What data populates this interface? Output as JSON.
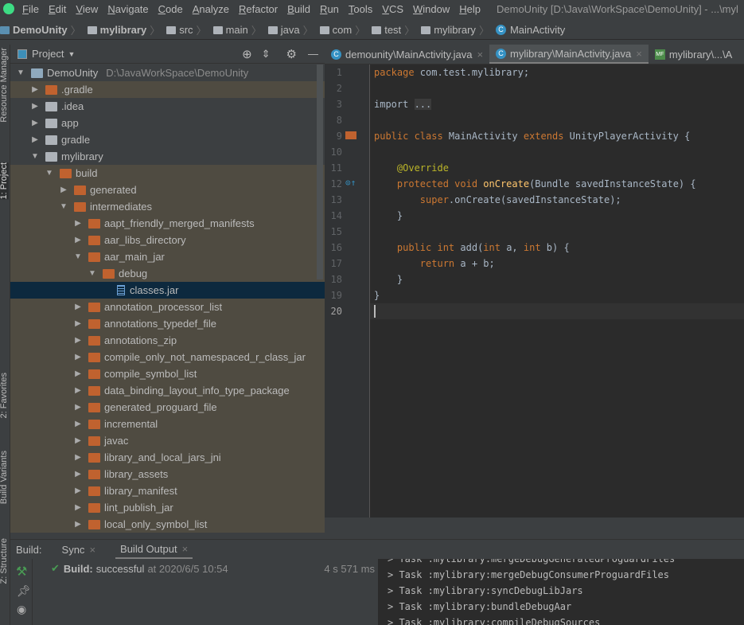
{
  "menu": [
    "File",
    "Edit",
    "View",
    "Navigate",
    "Code",
    "Analyze",
    "Refactor",
    "Build",
    "Run",
    "Tools",
    "VCS",
    "Window",
    "Help"
  ],
  "window_title": "DemoUnity [D:\\Java\\WorkSpace\\DemoUnity] - ...\\myl",
  "breadcrumb": [
    "DemoUnity",
    "mylibrary",
    "src",
    "main",
    "java",
    "com",
    "test",
    "mylibrary",
    "MainActivity"
  ],
  "left_strip": {
    "resource_manager": "Resource Manager",
    "project": "1: Project",
    "favorites": "2: Favorites",
    "build_variants": "Build Variants",
    "structure": "Z: Structure"
  },
  "project_panel": {
    "title": "Project",
    "root_path": "D:\\JavaWorkSpace\\DemoUnity"
  },
  "tree": [
    {
      "label": "DemoUnity",
      "depth": 0,
      "open": true,
      "icon": "module-folder",
      "excluded": false
    },
    {
      "label": ".gradle",
      "depth": 1,
      "open": false,
      "icon": "folder-excluded",
      "excluded": true
    },
    {
      "label": ".idea",
      "depth": 1,
      "open": false,
      "icon": "folder",
      "excluded": false
    },
    {
      "label": "app",
      "depth": 1,
      "open": false,
      "icon": "app-module",
      "excluded": false
    },
    {
      "label": "gradle",
      "depth": 1,
      "open": false,
      "icon": "folder",
      "excluded": false
    },
    {
      "label": "mylibrary",
      "depth": 1,
      "open": true,
      "icon": "library-module",
      "excluded": false
    },
    {
      "label": "build",
      "depth": 2,
      "open": true,
      "icon": "folder-excluded",
      "excluded": true
    },
    {
      "label": "generated",
      "depth": 3,
      "open": false,
      "icon": "folder-excluded",
      "excluded": true
    },
    {
      "label": "intermediates",
      "depth": 3,
      "open": true,
      "icon": "folder-excluded",
      "excluded": true
    },
    {
      "label": "aapt_friendly_merged_manifests",
      "depth": 4,
      "open": false,
      "icon": "folder-excluded",
      "excluded": true
    },
    {
      "label": "aar_libs_directory",
      "depth": 4,
      "open": false,
      "icon": "folder-excluded",
      "excluded": true
    },
    {
      "label": "aar_main_jar",
      "depth": 4,
      "open": true,
      "icon": "folder-excluded",
      "excluded": true
    },
    {
      "label": "debug",
      "depth": 5,
      "open": true,
      "icon": "folder-excluded",
      "excluded": true
    },
    {
      "label": "classes.jar",
      "depth": 6,
      "leaf": true,
      "icon": "jar",
      "selected": true
    },
    {
      "label": "annotation_processor_list",
      "depth": 4,
      "open": false,
      "icon": "folder-excluded",
      "excluded": true
    },
    {
      "label": "annotations_typedef_file",
      "depth": 4,
      "open": false,
      "icon": "folder-excluded",
      "excluded": true
    },
    {
      "label": "annotations_zip",
      "depth": 4,
      "open": false,
      "icon": "folder-excluded",
      "excluded": true
    },
    {
      "label": "compile_only_not_namespaced_r_class_jar",
      "depth": 4,
      "open": false,
      "icon": "folder-excluded",
      "excluded": true
    },
    {
      "label": "compile_symbol_list",
      "depth": 4,
      "open": false,
      "icon": "folder-excluded",
      "excluded": true
    },
    {
      "label": "data_binding_layout_info_type_package",
      "depth": 4,
      "open": false,
      "icon": "folder-excluded",
      "excluded": true
    },
    {
      "label": "generated_proguard_file",
      "depth": 4,
      "open": false,
      "icon": "folder-excluded",
      "excluded": true
    },
    {
      "label": "incremental",
      "depth": 4,
      "open": false,
      "icon": "folder-excluded",
      "excluded": true
    },
    {
      "label": "javac",
      "depth": 4,
      "open": false,
      "icon": "folder-excluded",
      "excluded": true
    },
    {
      "label": "library_and_local_jars_jni",
      "depth": 4,
      "open": false,
      "icon": "folder-excluded",
      "excluded": true
    },
    {
      "label": "library_assets",
      "depth": 4,
      "open": false,
      "icon": "folder-excluded",
      "excluded": true
    },
    {
      "label": "library_manifest",
      "depth": 4,
      "open": false,
      "icon": "folder-excluded",
      "excluded": true
    },
    {
      "label": "lint_publish_jar",
      "depth": 4,
      "open": false,
      "icon": "folder-excluded",
      "excluded": true
    },
    {
      "label": "local_only_symbol_list",
      "depth": 4,
      "open": false,
      "icon": "folder-excluded",
      "excluded": true
    }
  ],
  "editor_tabs": [
    {
      "label": "demounity\\MainActivity.java",
      "active": false
    },
    {
      "label": "mylibrary\\MainActivity.java",
      "active": true
    },
    {
      "label": "mylibrary\\...\\A",
      "active": false
    }
  ],
  "code": [
    {
      "n": "1",
      "t": [
        [
          "kw",
          "package "
        ],
        [
          "",
          "com.test.mylibrary;"
        ]
      ]
    },
    {
      "n": "2",
      "t": []
    },
    {
      "n": "3",
      "t": [
        [
          "",
          "import "
        ],
        [
          "fd",
          "..."
        ]
      ]
    },
    {
      "n": "8",
      "t": []
    },
    {
      "n": "9",
      "t": [
        [
          "kw",
          "public class "
        ],
        [
          "",
          "MainActivity "
        ],
        [
          "kw",
          "extends "
        ],
        [
          "",
          "UnityPlayerActivity {"
        ]
      ]
    },
    {
      "n": "10",
      "t": []
    },
    {
      "n": "11",
      "t": [
        [
          "",
          "    "
        ],
        [
          "an",
          "@Override"
        ]
      ]
    },
    {
      "n": "12",
      "t": [
        [
          "",
          "    "
        ],
        [
          "kw",
          "protected void "
        ],
        [
          "fn",
          "onCreate"
        ],
        [
          "",
          "(Bundle savedInstanceState) {"
        ]
      ]
    },
    {
      "n": "13",
      "t": [
        [
          "",
          "        "
        ],
        [
          "kw",
          "super"
        ],
        [
          "",
          ".onCreate(savedInstanceState);"
        ]
      ]
    },
    {
      "n": "14",
      "t": [
        [
          "",
          "    }"
        ]
      ]
    },
    {
      "n": "15",
      "t": []
    },
    {
      "n": "16",
      "t": [
        [
          "",
          "    "
        ],
        [
          "kw",
          "public int "
        ],
        [
          "",
          "add("
        ],
        [
          "kw",
          "int "
        ],
        [
          "",
          "a, "
        ],
        [
          "kw",
          "int "
        ],
        [
          "",
          "b) {"
        ]
      ]
    },
    {
      "n": "17",
      "t": [
        [
          "",
          "        "
        ],
        [
          "kw",
          "return "
        ],
        [
          "",
          "a + b;"
        ]
      ]
    },
    {
      "n": "18",
      "t": [
        [
          "",
          "    }"
        ]
      ]
    },
    {
      "n": "19",
      "t": [
        [
          "",
          "}"
        ]
      ]
    },
    {
      "n": "20",
      "t": []
    }
  ],
  "build": {
    "label": "Build:",
    "tabs": [
      "Sync",
      "Build Output"
    ],
    "status_label": "Build:",
    "status": "successful",
    "at": "at 2020/6/5 10:54",
    "duration": "4 s 571 ms"
  },
  "console": [
    "> Task :mylibrary:mergeDebugGeneratedProguardFiles",
    "> Task :mylibrary:mergeDebugConsumerProguardFiles",
    "> Task :mylibrary:syncDebugLibJars",
    "> Task :mylibrary:bundleDebugAar",
    "> Task :mylibrary:compileDebugSources"
  ]
}
